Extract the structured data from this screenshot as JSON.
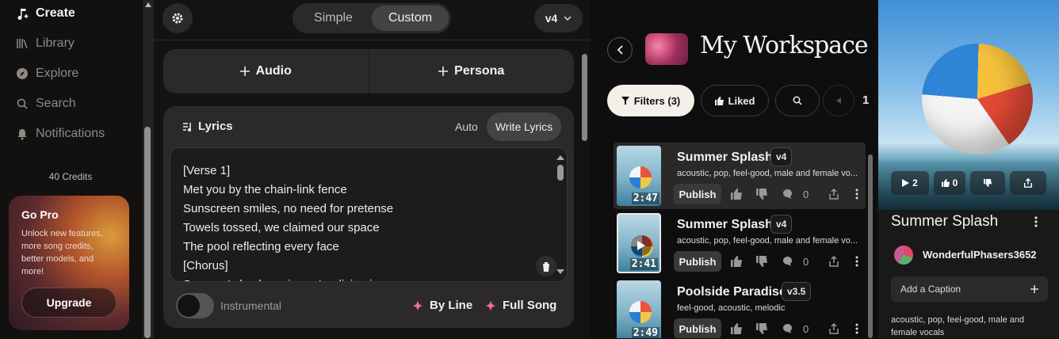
{
  "sidebar": {
    "nav": [
      {
        "label": "Create",
        "icon": "music-note-icon",
        "active": true
      },
      {
        "label": "Library",
        "icon": "library-icon",
        "active": false
      },
      {
        "label": "Explore",
        "icon": "compass-icon",
        "active": false
      },
      {
        "label": "Search",
        "icon": "search-icon",
        "active": false
      },
      {
        "label": "Notifications",
        "icon": "bell-icon",
        "active": false
      }
    ],
    "credits": "40 Credits",
    "promo": {
      "title": "Go Pro",
      "text": "Unlock new features, more song credits, better models, and more!",
      "button": "Upgrade"
    }
  },
  "create": {
    "modes": [
      "Simple",
      "Custom"
    ],
    "active_mode": "Custom",
    "version": "v4",
    "add_audio": "Audio",
    "add_persona": "Persona",
    "lyrics": {
      "title": "Lyrics",
      "auto": "Auto",
      "write": "Write Lyrics",
      "text": "[Verse 1]\nMet you by the chain-link fence\nSunscreen smiles, no need for pretense\nTowels tossed, we claimed our space\nThe pool reflecting every face\n[Chorus]\nSummer's back again, we're diving in"
    },
    "instrumental": "Instrumental",
    "by_line": "By Line",
    "full_song": "Full Song"
  },
  "workspace": {
    "title": "My Workspace",
    "filters": "Filters (3)",
    "liked": "Liked",
    "page": "1",
    "songs": [
      {
        "title": "Summer Splash",
        "version": "v4",
        "tags": "acoustic, pop, feel-good, male and female vo...",
        "duration": "2:47",
        "publish": "Publish",
        "comments": "0"
      },
      {
        "title": "Summer Splash",
        "version": "v4",
        "tags": "acoustic, pop, feel-good, male and female vo...",
        "duration": "2:41",
        "publish": "Publish",
        "comments": "0"
      },
      {
        "title": "Poolside Paradise",
        "version": "v3.5",
        "tags": "feel-good, acoustic, melodic",
        "duration": "2:49",
        "publish": "Publish",
        "comments": "0"
      }
    ]
  },
  "detail": {
    "plays": "2",
    "likes": "0",
    "title": "Summer Splash",
    "user": "WonderfulPhasers3652",
    "caption": "Add a Caption",
    "tags": "acoustic, pop, feel-good, male and female vocals"
  }
}
